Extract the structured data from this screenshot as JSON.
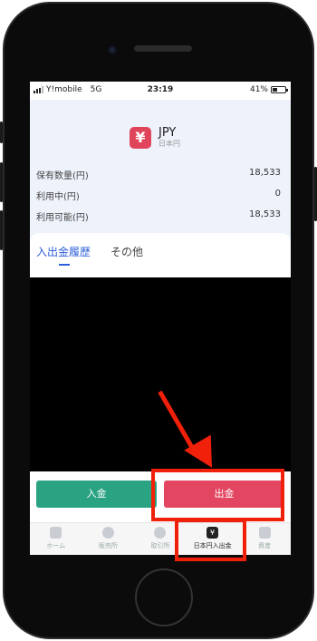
{
  "status_bar": {
    "carrier": "Y!mobile",
    "network": "5G",
    "time": "23:19",
    "battery": "41%",
    "battery_level": 0.41
  },
  "currency": {
    "symbol": "¥",
    "code": "JPY",
    "name": "日本円"
  },
  "balances": [
    {
      "label": "保有数量(円)",
      "value": "18,533"
    },
    {
      "label": "利用中(円)",
      "value": "0"
    },
    {
      "label": "利用可能(円)",
      "value": "18,533"
    }
  ],
  "tabs": [
    {
      "label": "入出金履歴",
      "active": true
    },
    {
      "label": "その他",
      "active": false
    }
  ],
  "actions": {
    "deposit_label": "入金",
    "withdraw_label": "出金"
  },
  "bottom_nav": [
    {
      "label": "ホーム",
      "icon": "home-icon",
      "active": false
    },
    {
      "label": "販売所",
      "icon": "exchange-icon",
      "active": false
    },
    {
      "label": "取引所",
      "icon": "trade-icon",
      "active": false
    },
    {
      "label": "日本円入出金",
      "icon": "yen-transfer-icon",
      "active": true
    },
    {
      "label": "資産",
      "icon": "wallet-icon",
      "active": false
    }
  ],
  "colors": {
    "accent_blue": "#2e5fd8",
    "deposit_green": "#2aa383",
    "withdraw_red": "#e24661",
    "badge_red": "#e0445a",
    "annotation_red": "#f0200a"
  }
}
